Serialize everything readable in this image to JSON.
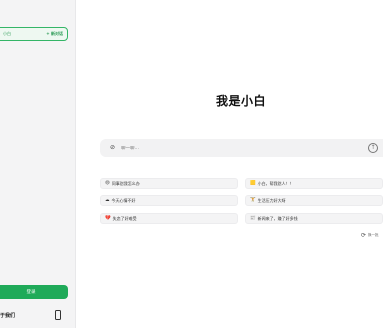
{
  "sidebar": {
    "current_chat": "小白",
    "new_chat_label": "+ 新对话",
    "login_label": "登录",
    "about_label": "于我们"
  },
  "main": {
    "title": "我是小白",
    "input_placeholder": "聊一聊…",
    "suggestions": [
      {
        "icon": "😄",
        "label": "同事怼我怎么办"
      },
      {
        "icon": "🟨",
        "label": "小白，帮我怼人！！"
      },
      {
        "icon": "☁",
        "label": "今天心情不好"
      },
      {
        "icon": "🏋",
        "label": "生活压力好大呀"
      },
      {
        "icon": "💔",
        "label": "失恋了好难受"
      },
      {
        "icon": "📰",
        "label": "新闻来了，赚了好多钱"
      }
    ],
    "refresh_label": "换一批"
  }
}
